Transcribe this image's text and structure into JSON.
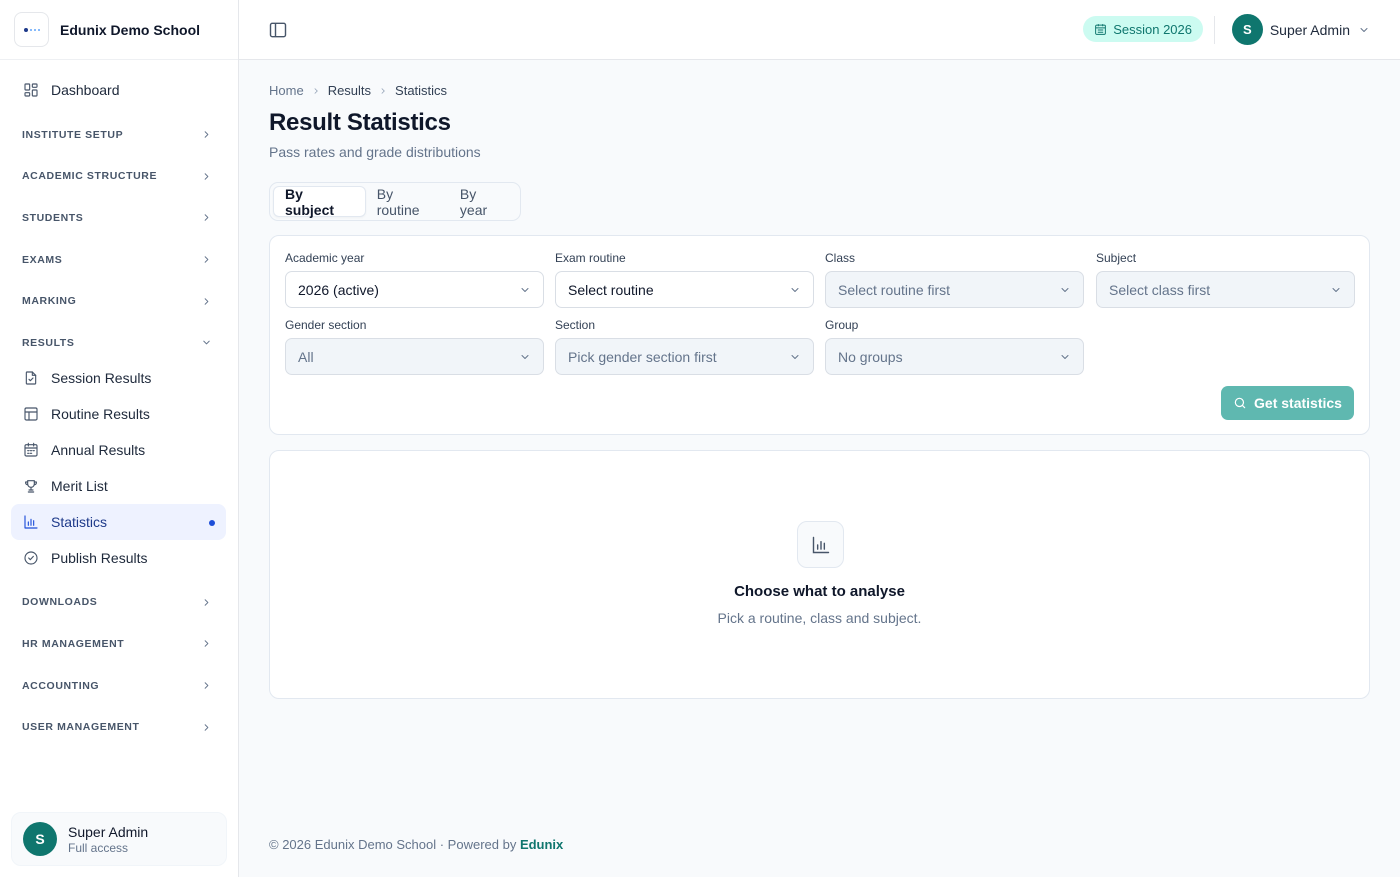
{
  "brand": {
    "name": "Edunix Demo School"
  },
  "sidebar": {
    "dashboard": "Dashboard",
    "sections": {
      "institute_setup": "INSTITUTE SETUP",
      "academic_structure": "ACADEMIC STRUCTURE",
      "students": "STUDENTS",
      "exams": "EXAMS",
      "marking": "MARKING",
      "results": "RESULTS",
      "downloads": "DOWNLOADS",
      "hr_management": "HR MANAGEMENT",
      "accounting": "ACCOUNTING",
      "user_management": "USER MANAGEMENT"
    },
    "results_items": [
      {
        "label": "Session Results",
        "icon": "file-check-icon"
      },
      {
        "label": "Routine Results",
        "icon": "table-icon"
      },
      {
        "label": "Annual Results",
        "icon": "calendar-grid-icon"
      },
      {
        "label": "Merit List",
        "icon": "trophy-icon"
      },
      {
        "label": "Statistics",
        "icon": "bar-chart-icon",
        "active": true
      },
      {
        "label": "Publish Results",
        "icon": "check-circle-icon"
      }
    ],
    "user": {
      "initial": "S",
      "name": "Super Admin",
      "role": "Full access"
    }
  },
  "topbar": {
    "session": "Session 2026",
    "user_initial": "S",
    "user_name": "Super Admin"
  },
  "breadcrumb": {
    "home": "Home",
    "section": "Results",
    "current": "Statistics"
  },
  "page": {
    "title": "Result Statistics",
    "subtitle": "Pass rates and grade distributions"
  },
  "tabs": [
    "By subject",
    "By routine",
    "By year"
  ],
  "filters": {
    "academic_year": {
      "label": "Academic year",
      "value": "2026 (active)"
    },
    "exam_routine": {
      "label": "Exam routine",
      "value": "Select routine"
    },
    "class": {
      "label": "Class",
      "value": "Select routine first"
    },
    "subject": {
      "label": "Subject",
      "value": "Select class first"
    },
    "gender_section": {
      "label": "Gender section",
      "value": "All"
    },
    "section": {
      "label": "Section",
      "value": "Pick gender section first"
    },
    "group": {
      "label": "Group",
      "value": "No groups"
    },
    "submit": "Get statistics"
  },
  "empty_state": {
    "title": "Choose what to analyse",
    "subtitle": "Pick a routine, class and subject."
  },
  "footer": {
    "text": "© 2026 Edunix Demo School · Powered by ",
    "link": "Edunix"
  },
  "colors": {
    "accent": "#0f766e",
    "active_nav": "#1d4ed8",
    "session_badge_bg": "#ccfbf1",
    "button_bg": "#5fb8b0"
  }
}
